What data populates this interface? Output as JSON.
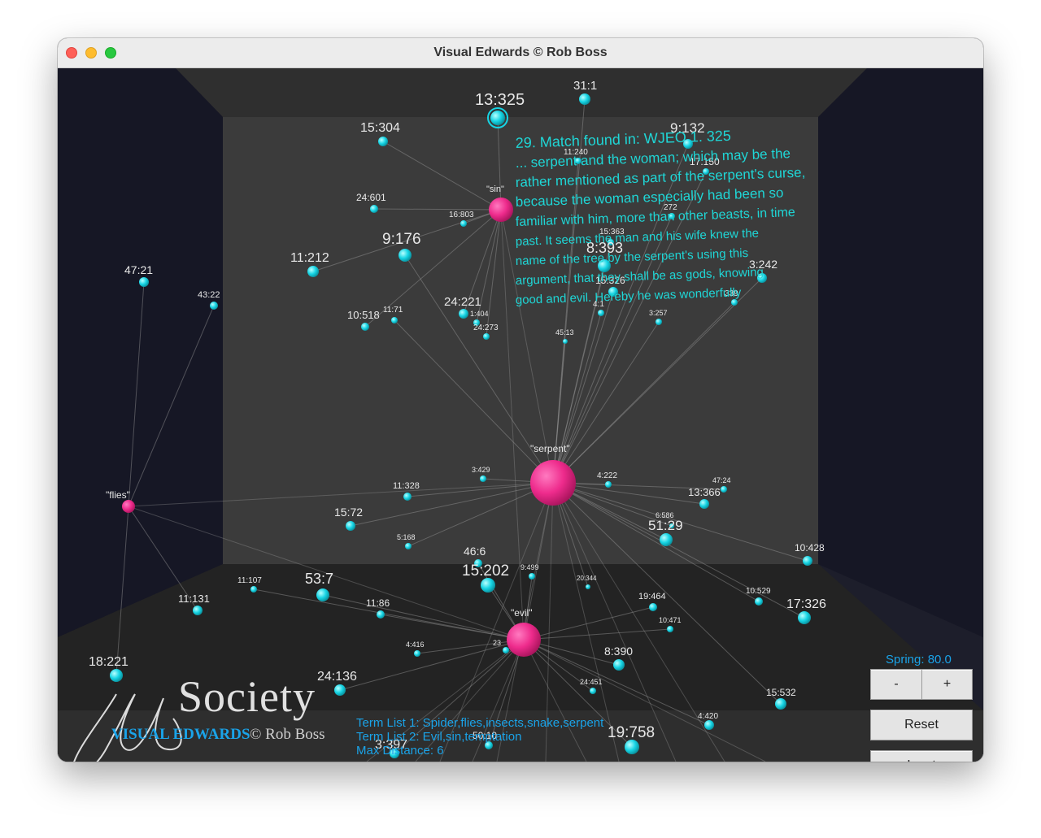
{
  "window": {
    "title": "Visual Edwards © Rob Boss"
  },
  "match_lines": [
    "29. Match found in: WJEO 1. 325",
    "... serpent and the woman; which may be the",
    "rather mentioned as part of the serpent's curse,",
    "because the woman especially had been so",
    "familiar with him, more than other beasts, in time",
    "past. It seems the man and his wife knew the",
    "name of the tree by the serpent's using this",
    "argument, that they shall be as gods, knowing",
    "good and evil. Hereby he was wonderfully"
  ],
  "term_nodes": [
    {
      "label": "\"serpent\""
    },
    {
      "label": "\"evil\""
    },
    {
      "label": "\"sin\""
    },
    {
      "label": "\"flies\""
    }
  ],
  "ref_nodes": [
    {
      "label": "13:325"
    },
    {
      "label": "31:1"
    },
    {
      "label": "15:304"
    },
    {
      "label": "9:132"
    },
    {
      "label": "11:240"
    },
    {
      "label": "17:150"
    },
    {
      "label": "24:601"
    },
    {
      "label": "16:803"
    },
    {
      "label": "9:176"
    },
    {
      "label": "11:212"
    },
    {
      "label": "47:21"
    },
    {
      "label": "43:22"
    },
    {
      "label": "15:363"
    },
    {
      "label": "8:393"
    },
    {
      "label": "272"
    },
    {
      "label": "3:242"
    },
    {
      "label": "15:326"
    },
    {
      "label": "24:221"
    },
    {
      "label": "1:404"
    },
    {
      "label": "10:518"
    },
    {
      "label": "11:71"
    },
    {
      "label": "24:273"
    },
    {
      "label": "4:1"
    },
    {
      "label": "3:257"
    },
    {
      "label": "339"
    },
    {
      "label": "45:13"
    },
    {
      "label": "3:429"
    },
    {
      "label": "4:222"
    },
    {
      "label": "47:24"
    },
    {
      "label": "13:366"
    },
    {
      "label": "11:328"
    },
    {
      "label": "15:72"
    },
    {
      "label": "6:586"
    },
    {
      "label": "51:29"
    },
    {
      "label": "5:168"
    },
    {
      "label": "10:428"
    },
    {
      "label": "46:6"
    },
    {
      "label": "15:202"
    },
    {
      "label": "9:499"
    },
    {
      "label": "20:344"
    },
    {
      "label": "53:7"
    },
    {
      "label": "11:107"
    },
    {
      "label": "11:131"
    },
    {
      "label": "11:86"
    },
    {
      "label": "10:529"
    },
    {
      "label": "19:464"
    },
    {
      "label": "17:326"
    },
    {
      "label": "10:471"
    },
    {
      "label": "4:416"
    },
    {
      "label": "23"
    },
    {
      "label": "8:390"
    },
    {
      "label": "18:221"
    },
    {
      "label": "24:136"
    },
    {
      "label": "24:451"
    },
    {
      "label": "15:532"
    },
    {
      "label": "4:420"
    },
    {
      "label": "19:758"
    },
    {
      "label": "50:10"
    },
    {
      "label": "3:397"
    }
  ],
  "controls": {
    "spring_label": "Spring: 80.0",
    "minus": "-",
    "plus": "+",
    "reset": "Reset",
    "input": "Input"
  },
  "footer": {
    "term_list_1": "Term List 1: Spider,flies,insects,snake,serpent",
    "term_list_2": "Term List 2: Evil,sin,temptation",
    "max_distance": "Max Distance: 6"
  },
  "logo": {
    "society": "Society",
    "visual_edwards": "VISUAL EDWARDS",
    "rob_boss": "© Rob Boss"
  },
  "colors": {
    "term_node": "#ee2b8c",
    "ref_node": "#16d4e4",
    "match_text": "#1fd6d6",
    "ui_text": "#1aa3e8",
    "back_wall": "#3b3b3b",
    "floor": "#232323"
  }
}
